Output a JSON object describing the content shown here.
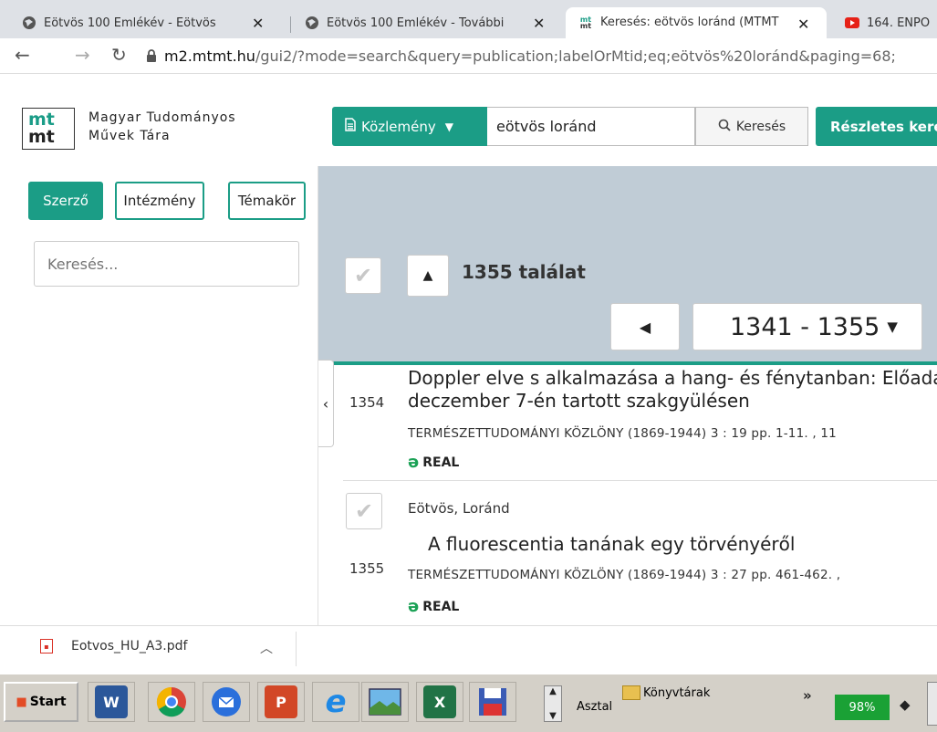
{
  "browser": {
    "tabs": [
      {
        "label": "Eötvös 100 Emlékév - Eötvös",
        "icon": "globe-icon",
        "active": false
      },
      {
        "label": "Eötvös 100 Emlékév - További",
        "icon": "globe-icon",
        "active": false
      },
      {
        "label": "Keresés: eötvös loránd (MTMT",
        "icon": "mtmt-favicon",
        "active": true
      },
      {
        "label": "164. ENPO",
        "icon": "youtube-icon",
        "active": false
      }
    ],
    "close_glyph": "✕",
    "url_host": "m2.mtmt.hu",
    "url_rest": "/gui2/?mode=search&query=publication;labelOrMtid;eq;eötvös%20loránd&paging=68;"
  },
  "site": {
    "logo_top": "mt",
    "logo_bottom": "mt",
    "name_line1": "Magyar Tudományos",
    "name_line2": "Művek Tára",
    "type_select": "Közlemény",
    "query": "eötvös loránd",
    "search_label": "Keresés",
    "advanced_label": "Részletes keresés"
  },
  "filters": {
    "tabs": [
      "Szerző",
      "Intézmény",
      "Témakör"
    ],
    "active_tab": "Szerző",
    "search_placeholder": "Keresés..."
  },
  "results": {
    "count_label": "1355 találat",
    "range_label": "1341 - 1355",
    "items": [
      {
        "number": "1354",
        "title_line1": "Doppler elve s alkalmazása a hang- és fénytanban: Előadás",
        "title_line2": "deczember 7-én tartott szakgyülésen",
        "journal": "TERMÉSZETTUDOMÁNYI KÖZLÖNY (1869-1944) 3 : 19 pp. 1-11. , 11",
        "repo": "REAL"
      },
      {
        "number": "1355",
        "author": "Eötvös, Loránd",
        "title_line1": "A fluorescentia tanának egy törvényéről",
        "journal": "TERMÉSZETTUDOMÁNYI KÖZLÖNY (1869-1944) 3 : 27 pp. 461-462. ,",
        "repo": "REAL"
      }
    ]
  },
  "download": {
    "file_name": "Eotvos_HU_A3.pdf"
  },
  "taskbar": {
    "start_label": "Start",
    "asztal_label": "Asztal",
    "konyvtarak_label": "Könyvtárak",
    "battery_label": "98%",
    "apps": [
      "word-icon",
      "chrome-icon",
      "thunderbird-icon",
      "powerpoint-icon",
      "internet-explorer-icon",
      "photo-viewer-icon",
      "excel-icon",
      "save-floppy-icon"
    ]
  },
  "colors": {
    "accent": "#1b9d86",
    "results_header_bg": "#c0ccd6",
    "open_access": "#1aa155",
    "battery": "#1aa135"
  }
}
